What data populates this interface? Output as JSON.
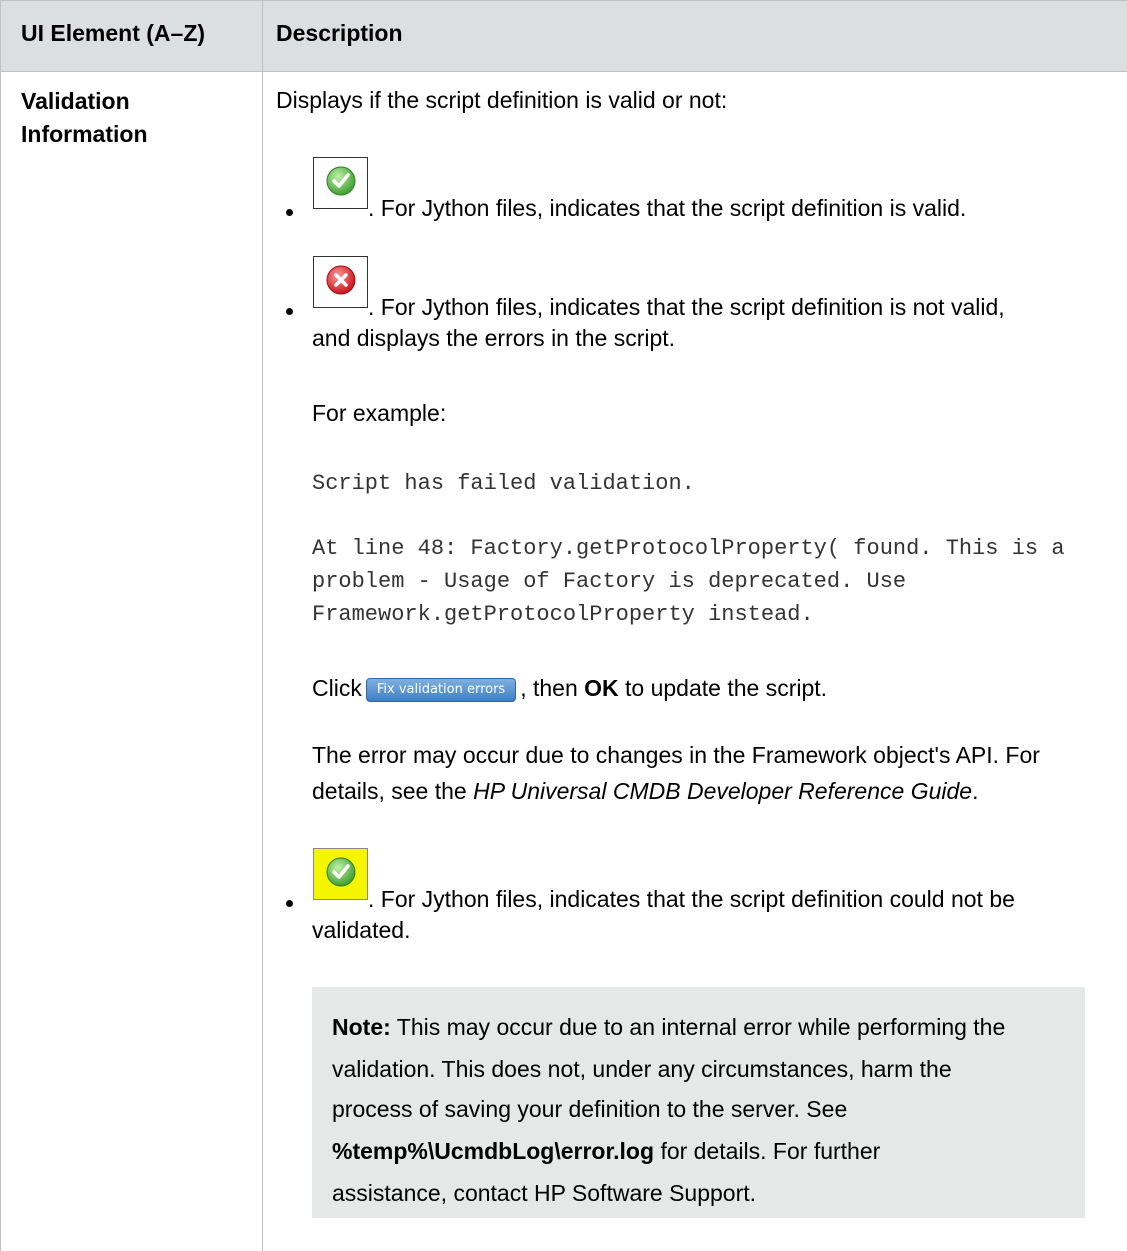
{
  "table": {
    "header": {
      "col1": "UI Element (A–Z)",
      "col2": "Description"
    },
    "row": {
      "element_line1": "Validation",
      "element_line2": "Information",
      "intro": "Displays if the script definition is valid or not:",
      "valid_text": ". For Jython files, indicates that the script definition is valid.",
      "invalid_text_line1": ". For Jython files, indicates that the script definition is not valid,",
      "invalid_text_line2": "and displays the errors in the script.",
      "for_example": "For example:",
      "code_line1": "Script has failed validation.",
      "code_line2": "At line 48: Factory.getProtocolProperty( found. This is a",
      "code_line3": "problem - Usage of Factory is deprecated. Use",
      "code_line4": "Framework.getProtocolProperty instead.",
      "click_prefix": "Click",
      "fix_button_label": "Fix validation errors",
      "click_mid": ", then",
      "click_ok": "OK",
      "click_suffix": "to update the script.",
      "error_line1": "The error may occur due to changes in the Framework object's API. For",
      "error_line2_prefix": "details, see the",
      "error_line2_ref": "HP Universal CMDB Developer Reference Guide",
      "error_line2_suffix": ".",
      "unvalidated_text_line1": ". For Jython files, indicates that the script definition could not be",
      "unvalidated_text_line2": "validated.",
      "note": {
        "label": "Note:",
        "line1": "This may occur due to an internal error while performing the",
        "line2": "validation. This does not, under any circumstances, harm the",
        "line3": "process of saving your definition to the server. See",
        "path": "%temp%\\UcmdbLog\\error.log",
        "line4_suffix": "for details. For further",
        "line5": "assistance, contact HP Software Support."
      }
    }
  },
  "icons": {
    "valid": "check-icon",
    "invalid": "error-icon",
    "unvalidated": "check-icon",
    "colors": {
      "valid": "#4caf3a",
      "invalid": "#d9262b",
      "unvalidated_bg": "#f5f500"
    }
  }
}
